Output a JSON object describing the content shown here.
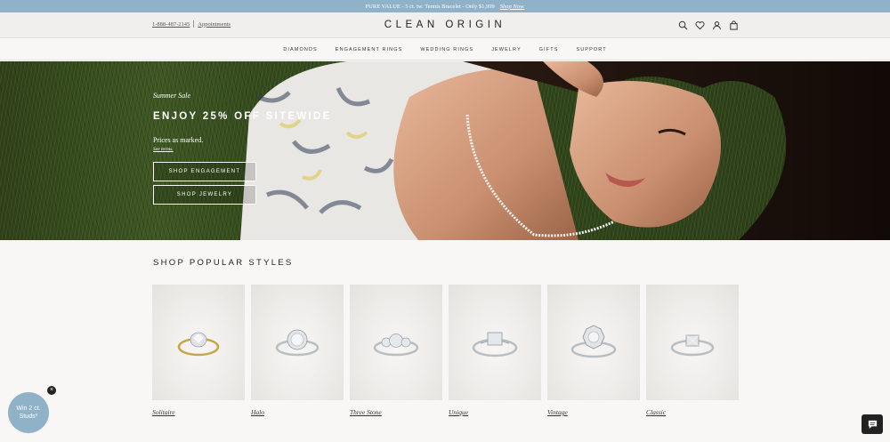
{
  "promo": {
    "text": "PURE VALUE - 5 ct. tw. Tennis Bracelet - Only $1,999",
    "link": "Shop Now."
  },
  "header": {
    "phone": "1-888-487-2145",
    "appointments": "Appointments",
    "logo": "CLEAN ORIGIN",
    "icons": [
      "search-icon",
      "heart-icon",
      "user-icon",
      "bag-icon"
    ]
  },
  "nav": {
    "items": [
      "DIAMONDS",
      "ENGAGEMENT RINGS",
      "WEDDING RINGS",
      "JEWELRY",
      "GIFTS",
      "SUPPORT"
    ]
  },
  "hero": {
    "eyebrow": "Summer Sale",
    "headline": "ENJOY 25% OFF SITEWIDE",
    "subtext": "Prices as marked.",
    "terms": "See terms.",
    "btn_engagement": "SHOP ENGAGEMENT",
    "btn_jewelry": "SHOP JEWELRY"
  },
  "styles": {
    "title": "SHOP POPULAR STYLES",
    "items": [
      {
        "label": "Solitaire"
      },
      {
        "label": "Halo"
      },
      {
        "label": "Three Stone"
      },
      {
        "label": "Unique"
      },
      {
        "label": "Vintage"
      },
      {
        "label": "Classic"
      }
    ]
  },
  "badge": {
    "line1": "Win 2 ct.",
    "line2": "Studs*"
  },
  "colors": {
    "promo_bar": "#8fb2c8",
    "header_bg": "#f0efed",
    "page_bg": "#f8f7f5"
  }
}
